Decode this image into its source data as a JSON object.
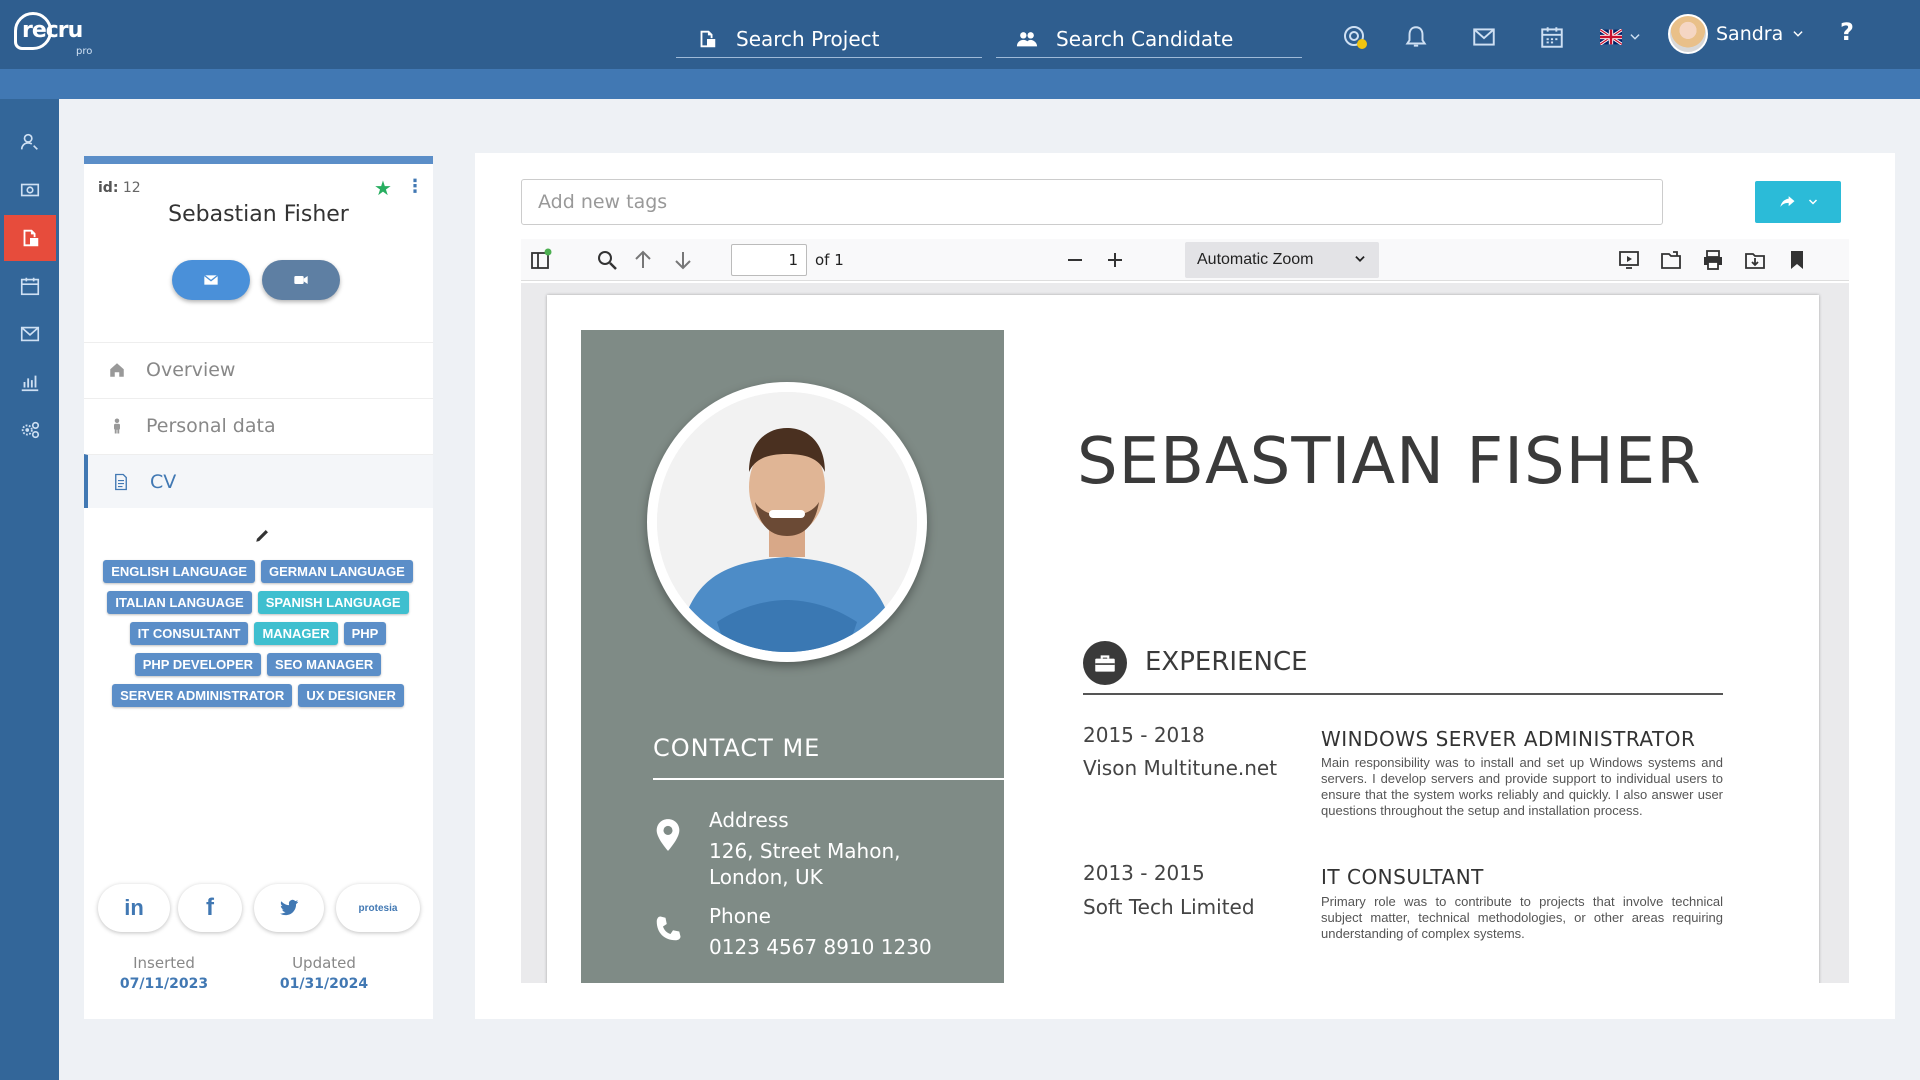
{
  "app": {
    "logo_text": "recru",
    "logo_sub": "pro"
  },
  "nav": {
    "search_project": "Search Project",
    "search_candidate": "Search Candidate",
    "user_name": "Sandra",
    "help": "?"
  },
  "profile": {
    "id_label": "id:",
    "id_value": "12",
    "name": "Sebastian Fisher",
    "menu": [
      "Overview",
      "Personal data",
      "CV"
    ],
    "tags": [
      {
        "label": "ENGLISH LANGUAGE",
        "color": "#5b8ec8"
      },
      {
        "label": "GERMAN LANGUAGE",
        "color": "#5b8ec8"
      },
      {
        "label": "ITALIAN LANGUAGE",
        "color": "#5b8ec8"
      },
      {
        "label": "SPANISH LANGUAGE",
        "color": "#3fbfcf"
      },
      {
        "label": "IT CONSULTANT",
        "color": "#5b8ec8"
      },
      {
        "label": "MANAGER",
        "color": "#3fbfcf"
      },
      {
        "label": "PHP",
        "color": "#5b8ec8"
      },
      {
        "label": "PHP DEVELOPER",
        "color": "#5b8ec8"
      },
      {
        "label": "SEO MANAGER",
        "color": "#5b8ec8"
      },
      {
        "label": "SERVER ADMINISTRATOR",
        "color": "#5b8ec8"
      },
      {
        "label": "UX DESIGNER",
        "color": "#5b8ec8"
      }
    ],
    "social": {
      "linkedin": "in",
      "facebook": "f",
      "protesia": "protesia"
    },
    "inserted_label": "Inserted",
    "inserted_value": "07/11/2023",
    "updated_label": "Updated",
    "updated_value": "01/31/2024"
  },
  "main": {
    "tags_placeholder": "Add new tags",
    "pdf": {
      "page_value": "1",
      "of_pages": "of 1",
      "zoom": "Automatic Zoom"
    }
  },
  "cv": {
    "name": "SEBASTIAN FISHER",
    "contact_title": "CONTACT ME",
    "address_label": "Address",
    "address_value": "126, Street Mahon, London, UK",
    "phone_label": "Phone",
    "phone_value": "0123 4567 8910 1230",
    "experience_title": "EXPERIENCE",
    "jobs": [
      {
        "years": "2015 - 2018",
        "company": "Vison Multitune.net",
        "title": "WINDOWS SERVER ADMINISTRATOR",
        "desc": "Main responsibility was to install and set up Windows systems and servers. I develop servers and provide support to individual users to ensure that the system works reliably and quickly. I also answer user questions throughout the setup and installation process."
      },
      {
        "years": "2013 - 2015",
        "company": "Soft Tech Limited",
        "title": "IT CONSULTANT",
        "desc": "Primary role was to contribute to projects that involve technical subject matter, technical methodologies, or other areas requiring understanding of complex systems."
      }
    ]
  },
  "colors": {
    "nav_bg": "#2f5e8f",
    "sidebar_bg": "#336699",
    "active_item": "#e74c3c",
    "accent": "#4178b3",
    "share_button": "#2bbbd8",
    "cv_side": "#7f8b86"
  }
}
